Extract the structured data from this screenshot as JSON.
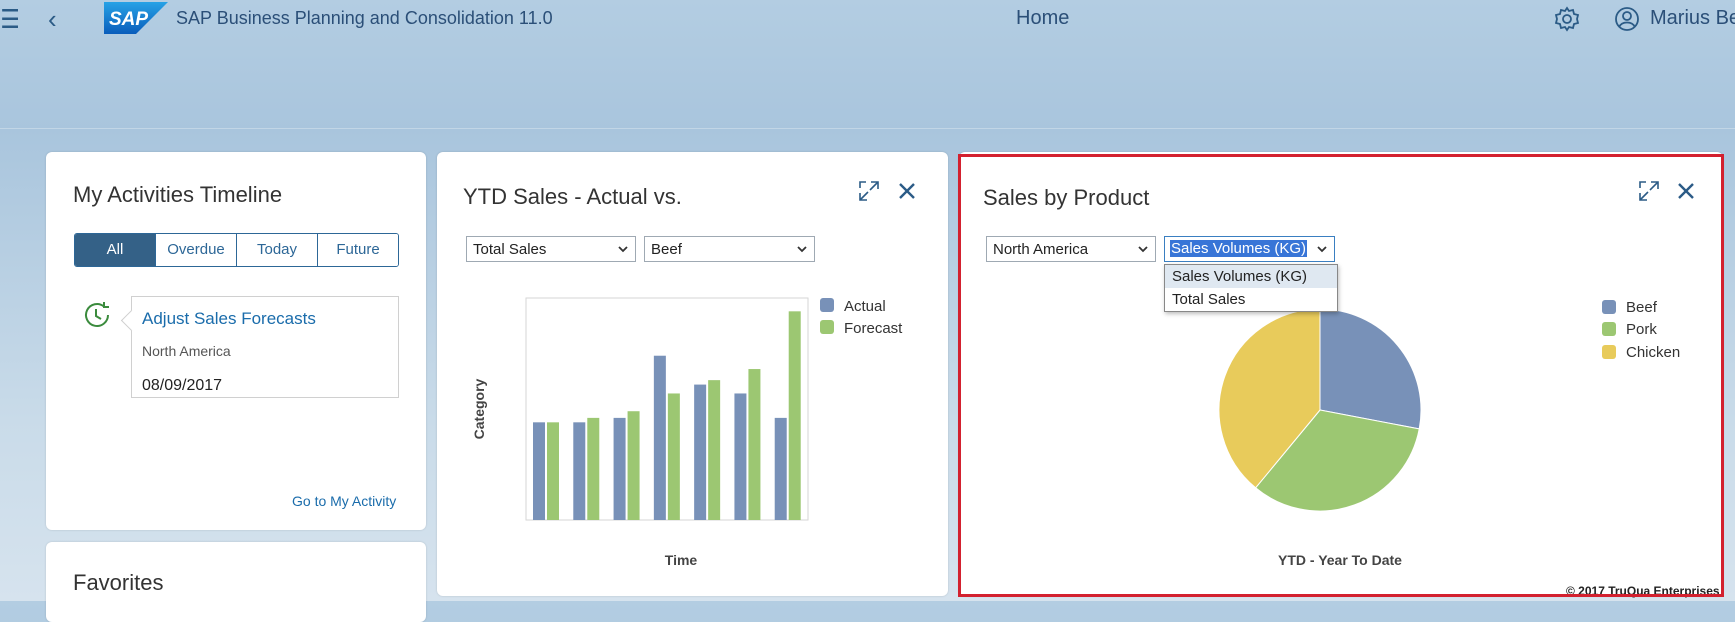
{
  "shell": {
    "app_title": "SAP Business Planning and Consolidation 11.0",
    "page_title": "Home",
    "user_name": "Marius Be",
    "logo_text": "SAP"
  },
  "activities": {
    "title": "My Activities Timeline",
    "filters": [
      "All",
      "Overdue",
      "Today",
      "Future"
    ],
    "active_filter": "All",
    "item": {
      "title": "Adjust Sales Forecasts",
      "subtitle": "North America",
      "date": "08/09/2017"
    },
    "link": "Go to My Activity"
  },
  "favorites": {
    "title": "Favorites"
  },
  "ytd_tile": {
    "title": "YTD Sales - Actual vs.",
    "measure_select": "Total Sales",
    "product_select": "Beef",
    "xlabel": "Time",
    "ylabel": "Category",
    "legend": [
      "Actual",
      "Forecast"
    ]
  },
  "product_tile": {
    "title": "Sales by Product",
    "region_select": "North America",
    "measure_select": "Sales Volumes (KG)",
    "dropdown_options": [
      "Sales Volumes (KG)",
      "Total Sales"
    ],
    "xlabel": "YTD - Year To Date",
    "legend": [
      "Beef",
      "Pork",
      "Chicken"
    ],
    "copyright": "© 2017 TruQua Enterprises"
  },
  "colors": {
    "actual": "#7891b8",
    "forecast": "#9cc772",
    "beef": "#7891b8",
    "pork": "#9cc772",
    "chicken": "#e8cb5b",
    "brand": "#2b5b86",
    "highlight": "#d3212f"
  },
  "chart_data": [
    {
      "type": "bar",
      "categories": [
        "",
        "",
        "",
        "",
        "",
        "",
        ""
      ],
      "series": [
        {
          "name": "Actual",
          "values": [
            44,
            44,
            46,
            74,
            61,
            57,
            46
          ]
        },
        {
          "name": "Forecast",
          "values": [
            44,
            46,
            49,
            57,
            63,
            68,
            94
          ]
        }
      ],
      "xlabel": "Time",
      "ylabel": "Category",
      "ylim": [
        0,
        100
      ],
      "grid": false,
      "legend": "top-right"
    },
    {
      "type": "pie",
      "labels": [
        "Beef",
        "Pork",
        "Chicken"
      ],
      "values": [
        28,
        33,
        39
      ],
      "xlabel": "YTD - Year To Date",
      "legend": "top-right"
    }
  ]
}
